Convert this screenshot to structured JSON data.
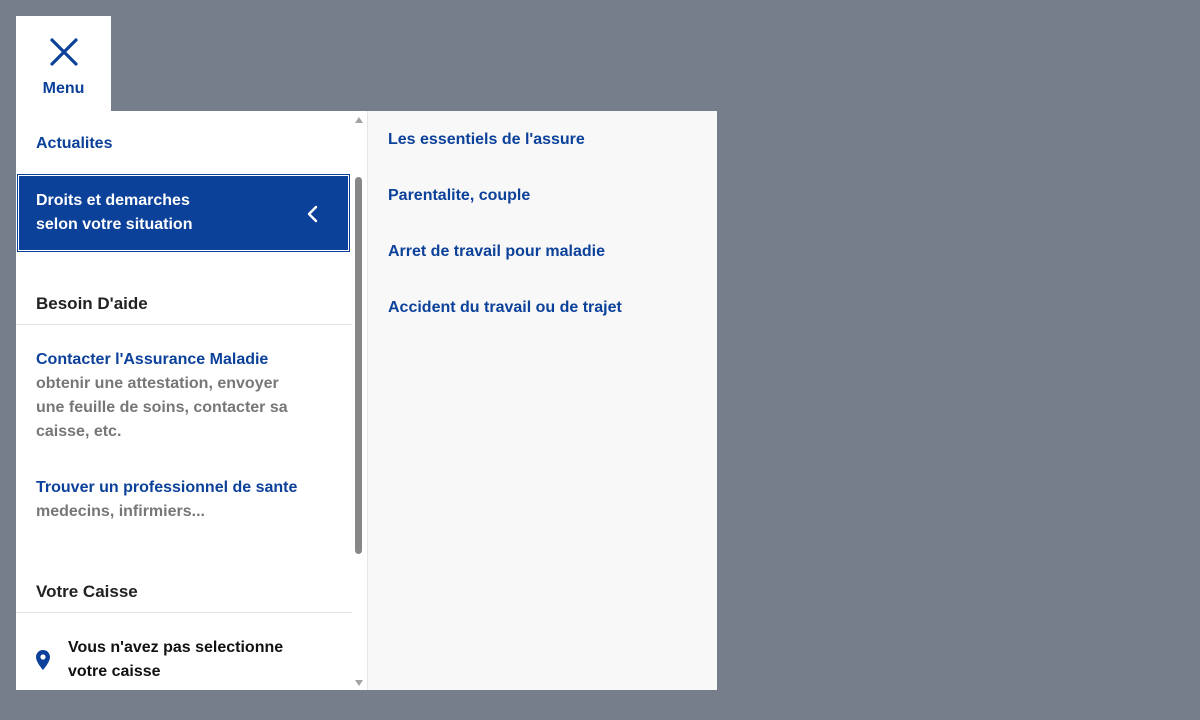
{
  "menu_toggle": {
    "label": "Menu",
    "icon": "close-icon"
  },
  "left_nav": {
    "actualites": "Actualites",
    "active_item": {
      "line1": "Droits et demarches",
      "line2": "selon votre situation",
      "icon": "chevron-left-icon"
    },
    "besoin_aide": {
      "title": "Besoin D'aide",
      "contact": {
        "link": "Contacter l'Assurance Maladie",
        "desc": "obtenir une attestation, envoyer une feuille de soins, contacter sa caisse, etc."
      },
      "trouver": {
        "link": "Trouver un professionnel de sante",
        "desc": "medecins, infirmiers..."
      }
    },
    "votre_caisse": {
      "title": "Votre Caisse",
      "text": "Vous n'avez pas selectionne votre caisse",
      "icon": "location-pin-icon"
    }
  },
  "right_nav": {
    "items": [
      "Les essentiels de l'assure",
      "Parentalite, couple",
      "Arret de travail pour maladie",
      "Accident du travail ou de trajet"
    ]
  },
  "colors": {
    "brand_blue": "#0c419a",
    "overlay": "#767e8c",
    "muted_text": "#777777"
  }
}
